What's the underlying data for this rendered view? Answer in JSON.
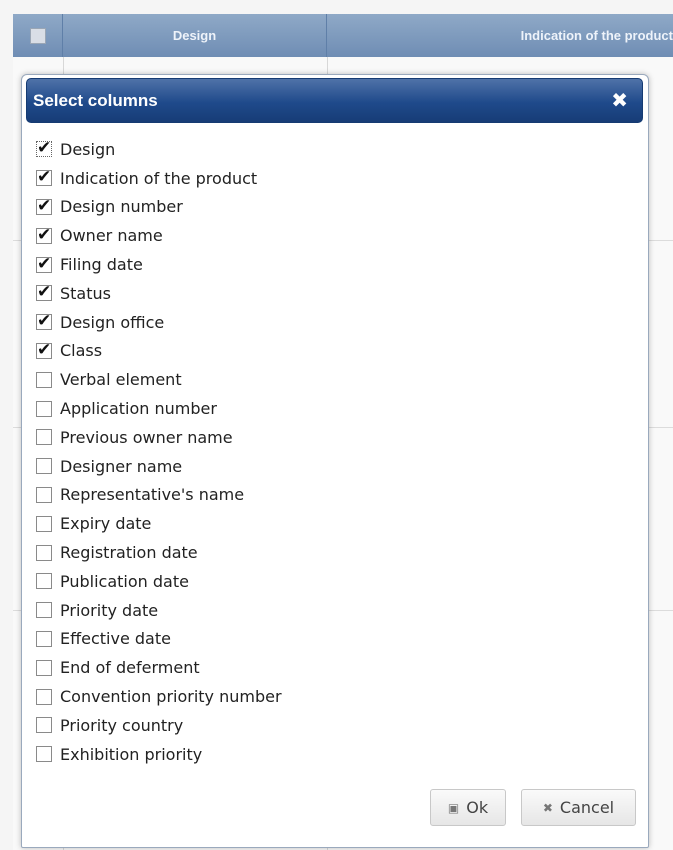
{
  "grid": {
    "headers": {
      "design": "Design",
      "indication": "Indication of the product"
    }
  },
  "dialog": {
    "title": "Select columns",
    "close_glyph": "✖",
    "columns": [
      {
        "label": "Design",
        "checked": true
      },
      {
        "label": "Indication of the product",
        "checked": true
      },
      {
        "label": "Design number",
        "checked": true
      },
      {
        "label": "Owner name",
        "checked": true
      },
      {
        "label": "Filing date",
        "checked": true
      },
      {
        "label": "Status",
        "checked": true
      },
      {
        "label": "Design office",
        "checked": true
      },
      {
        "label": "Class",
        "checked": true
      },
      {
        "label": "Verbal element",
        "checked": false
      },
      {
        "label": "Application number",
        "checked": false
      },
      {
        "label": "Previous owner name",
        "checked": false
      },
      {
        "label": "Designer name",
        "checked": false
      },
      {
        "label": "Representative's name",
        "checked": false
      },
      {
        "label": "Expiry date",
        "checked": false
      },
      {
        "label": "Registration date",
        "checked": false
      },
      {
        "label": "Publication date",
        "checked": false
      },
      {
        "label": "Priority date",
        "checked": false
      },
      {
        "label": "Effective date",
        "checked": false
      },
      {
        "label": "End of deferment",
        "checked": false
      },
      {
        "label": "Convention priority number",
        "checked": false
      },
      {
        "label": "Priority country",
        "checked": false
      },
      {
        "label": "Exhibition priority",
        "checked": false
      }
    ],
    "ok_label": "Ok",
    "ok_icon": "save-icon",
    "cancel_label": "Cancel",
    "cancel_icon": "close-icon"
  },
  "colors": {
    "header_bg": "#6f8db4",
    "titlebar_bg": "#1f4a8b"
  }
}
